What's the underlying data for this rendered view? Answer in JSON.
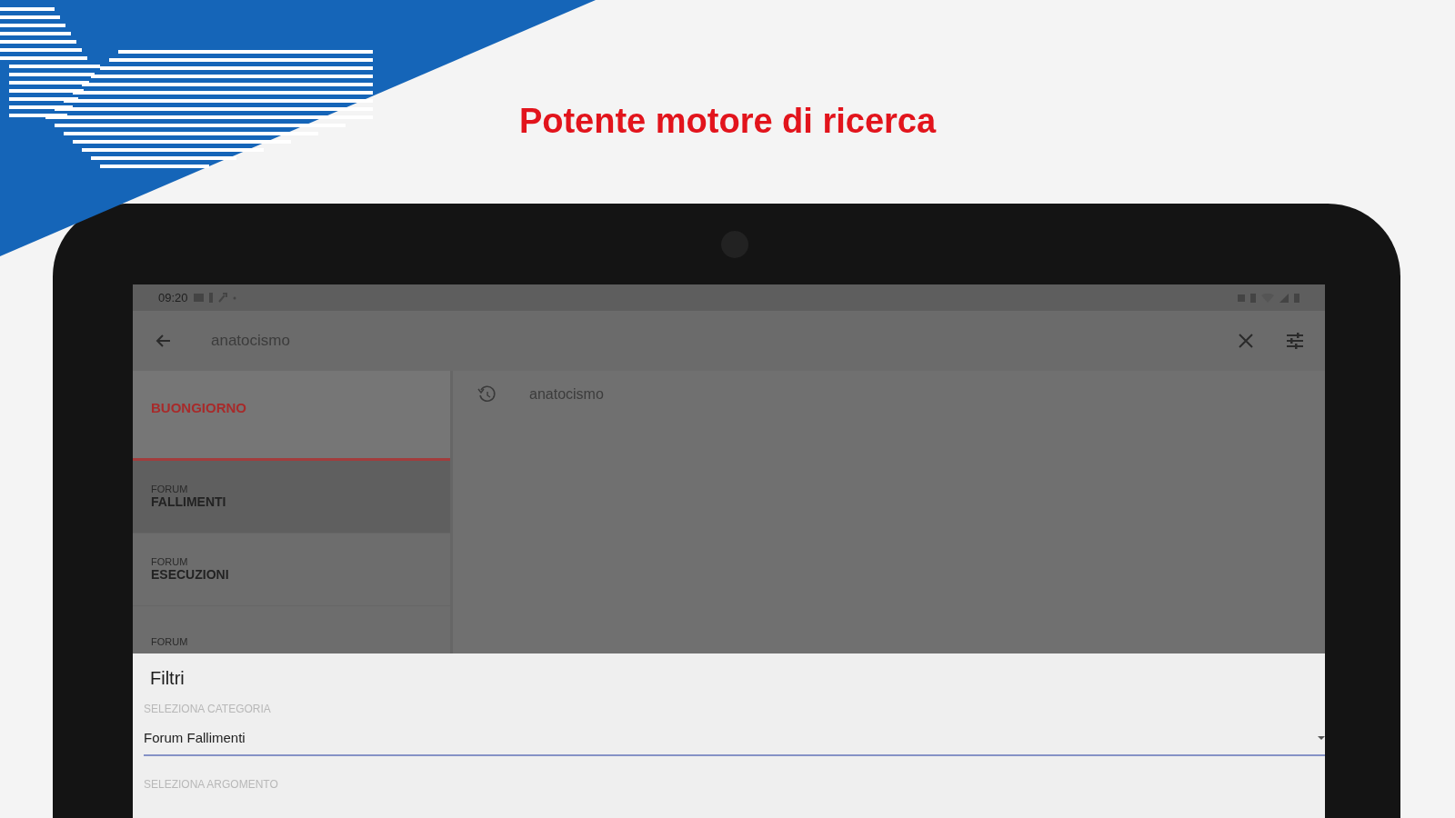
{
  "headline": "Potente motore di ricerca",
  "status_bar": {
    "time": "09:20"
  },
  "search": {
    "value": "anatocismo"
  },
  "sections": [
    {
      "kind": "header",
      "title": "BUONGIORNO",
      "selected": false
    },
    {
      "kind": "forum",
      "overline": "FORUM",
      "title": "FALLIMENTI",
      "selected": true
    },
    {
      "kind": "forum",
      "overline": "FORUM",
      "title": "ESECUZIONI",
      "selected": false
    },
    {
      "kind": "forum",
      "overline": "FORUM",
      "selected": false
    }
  ],
  "suggestions": [
    {
      "text": "anatocismo"
    }
  ],
  "filters": {
    "title": "Filtri",
    "fields": [
      {
        "kind": "dropdown",
        "label": "SELEZIONA CATEGORIA",
        "value": "Forum Fallimenti"
      },
      {
        "kind": "dropdown",
        "label": "SELEZIONA ARGOMENTO"
      }
    ]
  }
}
